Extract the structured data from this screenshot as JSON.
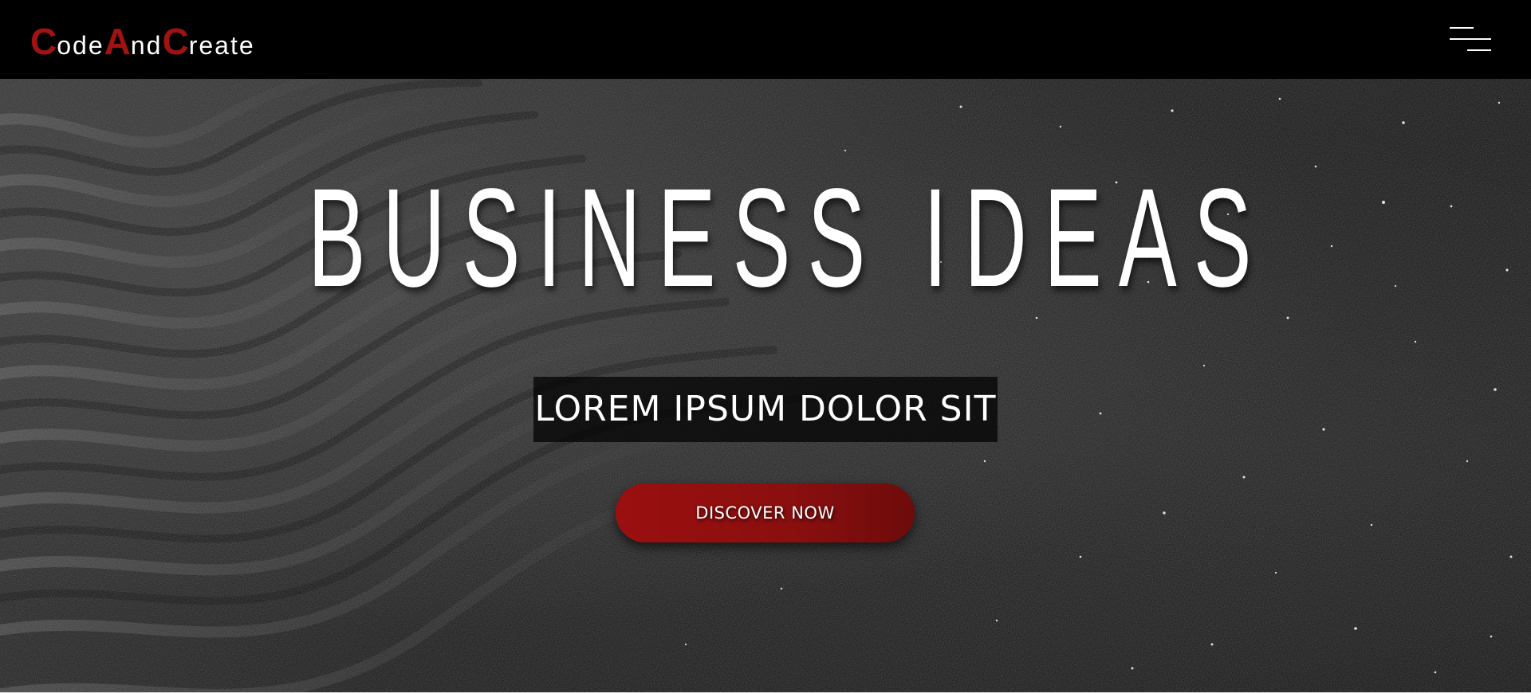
{
  "brand": {
    "logo_parts": [
      "C",
      "ode",
      "A",
      "nd",
      "C",
      "reate"
    ],
    "accent_color": "#a11212"
  },
  "header": {
    "menu_icon": "hamburger-menu-icon"
  },
  "hero": {
    "headline": "BUSINESS IDEAS",
    "subtitle": "LOREM IPSUM DOLOR SIT",
    "cta_label": "DISCOVER NOW",
    "cta_color": "#9b0f0f",
    "background": "dark-sand-dunes-texture"
  }
}
